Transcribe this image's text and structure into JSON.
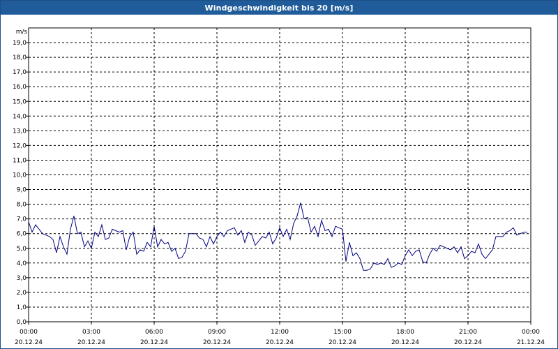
{
  "window": {
    "title": "Windgeschwindigkeit bis 20 [m/s]"
  },
  "chart_data": {
    "type": "line",
    "title": "Windgeschwindigkeit bis 20 [m/s]",
    "ylabel": "m/s",
    "ylim": [
      0,
      20
    ],
    "y_ticks": [
      "0,0",
      "1,0",
      "2,0",
      "3,0",
      "4,0",
      "5,0",
      "6,0",
      "7,0",
      "8,0",
      "9,0",
      "10,0",
      "11,0",
      "12,0",
      "13,0",
      "14,0",
      "15,0",
      "16,0",
      "17,0",
      "18,0",
      "19,0"
    ],
    "xlim_hours": [
      0,
      24
    ],
    "x_ticks": [
      {
        "time": "00:00",
        "date": "20.12.24"
      },
      {
        "time": "03:00",
        "date": "20.12.24"
      },
      {
        "time": "06:00",
        "date": "20.12.24"
      },
      {
        "time": "09:00",
        "date": "20.12.24"
      },
      {
        "time": "12:00",
        "date": "20.12.24"
      },
      {
        "time": "15:00",
        "date": "20.12.24"
      },
      {
        "time": "18:00",
        "date": "20.12.24"
      },
      {
        "time": "21:00",
        "date": "20.12.24"
      },
      {
        "time": "00:00",
        "date": "21.12.24"
      }
    ],
    "grid": true,
    "line_color": "#000080",
    "series": [
      {
        "x": [
          "00:00",
          "00:10",
          "00:20",
          "00:30",
          "00:40",
          "00:50",
          "01:00",
          "01:10",
          "01:20",
          "01:30",
          "01:40",
          "01:50",
          "02:00",
          "02:10",
          "02:20",
          "02:30",
          "02:40",
          "02:50",
          "03:00",
          "03:10",
          "03:20",
          "03:30",
          "03:40",
          "03:50",
          "04:00",
          "04:10",
          "04:20",
          "04:30",
          "04:40",
          "04:50",
          "05:00",
          "05:10",
          "05:20",
          "05:30",
          "05:40",
          "05:50",
          "06:00",
          "06:10",
          "06:20",
          "06:30",
          "06:40",
          "06:50",
          "07:00",
          "07:10",
          "07:20",
          "07:30",
          "07:40",
          "07:50",
          "08:00",
          "08:10",
          "08:20",
          "08:30",
          "08:40",
          "08:50",
          "09:00",
          "09:10",
          "09:20",
          "09:30",
          "09:40",
          "09:50",
          "10:00",
          "10:10",
          "10:20",
          "10:30",
          "10:40",
          "10:50",
          "11:00",
          "11:10",
          "11:20",
          "11:30",
          "11:40",
          "11:50",
          "12:00",
          "12:10",
          "12:20",
          "12:30",
          "12:40",
          "12:50",
          "13:00",
          "13:10",
          "13:20",
          "13:30",
          "13:40",
          "13:50",
          "14:00",
          "14:10",
          "14:20",
          "14:30",
          "14:40",
          "14:50",
          "15:00",
          "15:10",
          "15:20",
          "15:30",
          "15:40",
          "15:50",
          "16:00",
          "16:10",
          "16:20",
          "16:30",
          "16:40",
          "16:50",
          "17:00",
          "17:10",
          "17:20",
          "17:30",
          "17:40",
          "17:50",
          "18:00",
          "18:10",
          "18:20",
          "18:30",
          "18:40",
          "18:50",
          "19:00",
          "19:10",
          "19:20",
          "19:30",
          "19:40",
          "19:50",
          "20:00",
          "20:10",
          "20:20",
          "20:30",
          "20:40",
          "20:50",
          "21:00",
          "21:10",
          "21:20",
          "21:30",
          "21:40",
          "21:50",
          "22:00",
          "22:10",
          "22:20",
          "22:30",
          "22:40",
          "22:50",
          "23:00",
          "23:10",
          "23:20",
          "23:30",
          "23:40",
          "23:50"
        ],
        "y": [
          6.8,
          6.1,
          6.6,
          6.3,
          6.0,
          5.9,
          5.8,
          5.6,
          4.7,
          5.8,
          5.1,
          4.6,
          6.3,
          7.2,
          6.0,
          6.1,
          5.1,
          5.5,
          5.0,
          6.1,
          5.8,
          6.6,
          5.6,
          5.7,
          6.3,
          6.2,
          6.1,
          6.2,
          4.9,
          5.8,
          6.1,
          4.6,
          4.9,
          4.8,
          5.4,
          5.1,
          6.5,
          5.1,
          5.6,
          5.3,
          5.4,
          4.8,
          5.0,
          4.3,
          4.4,
          4.8,
          6.0,
          6.0,
          6.0,
          5.7,
          5.6,
          5.1,
          5.8,
          5.3,
          5.8,
          6.1,
          5.8,
          6.2,
          6.3,
          6.4,
          5.9,
          6.2,
          5.4,
          6.1,
          5.9,
          5.2,
          5.5,
          5.8,
          5.7,
          6.1,
          5.3,
          5.7,
          6.4,
          5.8,
          6.3,
          5.6,
          6.7,
          7.2,
          8.1,
          7.0,
          7.1,
          6.1,
          6.5,
          5.8,
          6.9,
          6.2,
          6.3,
          5.8,
          6.5,
          6.4,
          6.3,
          4.1,
          5.4,
          4.5,
          4.7,
          4.3,
          3.5,
          3.5,
          3.6,
          4.0,
          3.9,
          4.0,
          3.9,
          4.3,
          3.7,
          3.8,
          4.0,
          3.9,
          4.5,
          4.9,
          4.5,
          4.8,
          4.9,
          4.1,
          4.0,
          4.6,
          5.0,
          4.8,
          5.2,
          5.1,
          5.0,
          4.9,
          5.1,
          4.7,
          5.1,
          4.3,
          4.5,
          4.8,
          4.7,
          5.3,
          4.6,
          4.3,
          4.6,
          4.9,
          5.8,
          5.8,
          5.8,
          6.1,
          6.2,
          6.4,
          5.9,
          6.0,
          6.1,
          6.1
        ]
      }
    ]
  }
}
